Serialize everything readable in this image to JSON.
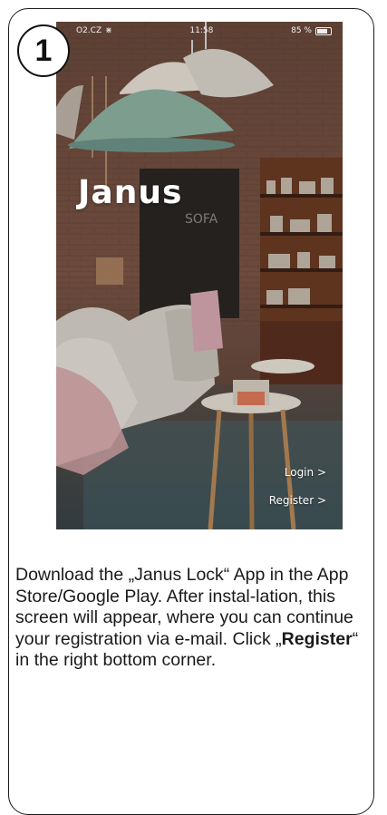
{
  "step": {
    "number": "1"
  },
  "status_bar": {
    "carrier": "O2.CZ",
    "time": "11:58",
    "battery": "85 %"
  },
  "app": {
    "brand": "Janus",
    "login_link": "Login >",
    "register_link": "Register >"
  },
  "description": {
    "part1": "Download the „Janus Lock“ App in the App Store/Google Play. After instal-lation, this screen will appear, where you can continue your registration via e-mail. Click „",
    "bold": "Register",
    "part2": "“ in the right bottom corner."
  },
  "colors": {
    "lamp_green": "#8fb3a3",
    "text": "#1a1a1a",
    "overlay_text": "#ffffff"
  }
}
